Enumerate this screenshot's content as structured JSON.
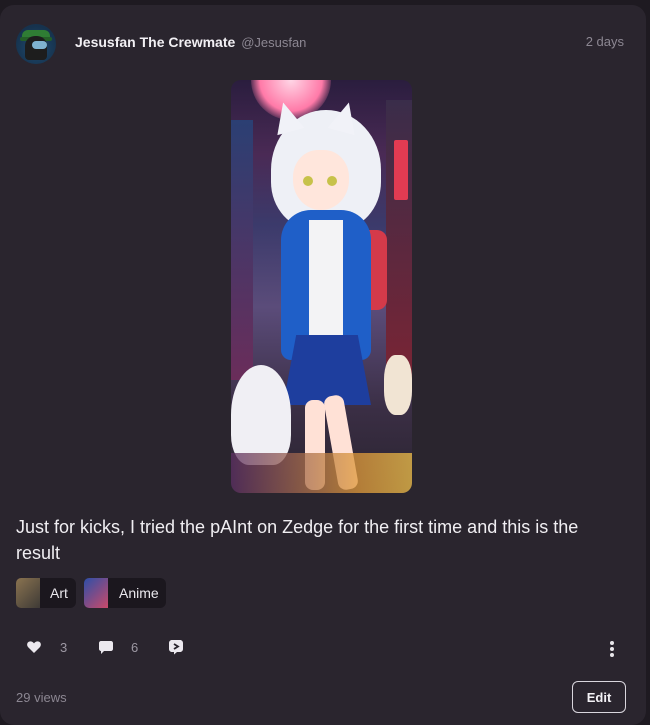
{
  "post": {
    "author": "Jesusfan The Crewmate",
    "handle": "@Jesusfan",
    "time": "2 days",
    "caption": "Just for kicks, I tried the pAInt on Zedge for the first time and this is the result"
  },
  "tags": [
    {
      "label": "Art",
      "thumb_color": "#6b5a45"
    },
    {
      "label": "Anime",
      "thumb_color": "#3b5fb0"
    }
  ],
  "actions": {
    "likes": "3",
    "comments": "6"
  },
  "footer": {
    "views": "29 views",
    "edit_label": "Edit"
  },
  "colors": {
    "background": "#1e1a21",
    "card": "#2a252e",
    "muted_text": "#8c8792"
  },
  "icons": [
    "heart-icon",
    "comment-icon",
    "share-icon",
    "more-options-icon"
  ]
}
